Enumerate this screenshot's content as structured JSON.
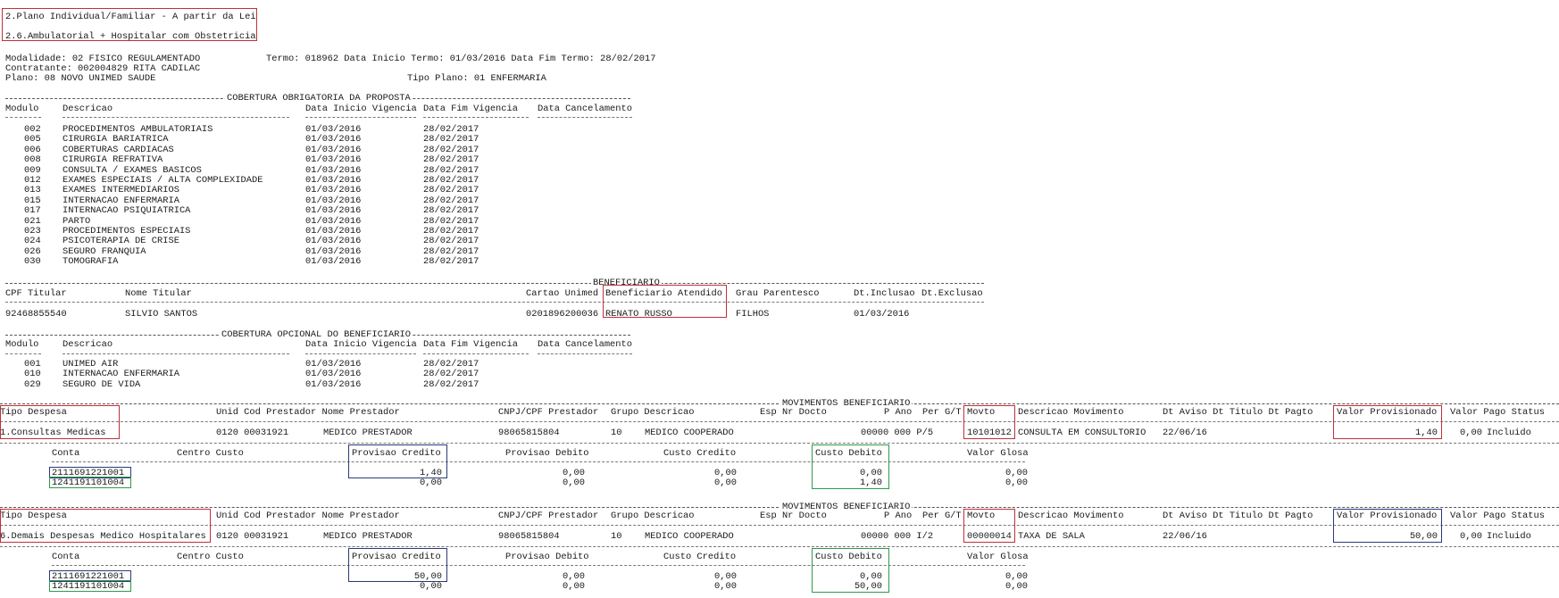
{
  "plan_box": {
    "line1": "2.Plano Individual/Familiar - A partir da Lei",
    "line2": "2.6.Ambulatorial + Hospitalar com Obstetricia"
  },
  "header": {
    "modalidade": "Modalidade: 02 FISICO REGULAMENTADO",
    "termo": "Termo: 018962 Data Inicio Termo: 01/03/2016 Data Fim Termo: 28/02/2017",
    "contratante": "Contratante: 002004829 RITA CADILAC",
    "plano": "Plano: 08 NOVO UNIMED SAUDE",
    "tipo_plano": "Tipo Plano: 01 ENFERMARIA"
  },
  "cobertura_obrigatoria": {
    "title": "COBERTURA OBRIGATORIA DA PROPOSTA",
    "headers": [
      "Modulo",
      "Descricao",
      "Data Inicio Vigencia",
      "Data Fim Vigencia",
      "Data Cancelamento"
    ],
    "rows": [
      [
        "002",
        "PROCEDIMENTOS AMBULATORIAIS",
        "01/03/2016",
        "28/02/2017"
      ],
      [
        "005",
        "CIRURGIA BARIATRICA",
        "01/03/2016",
        "28/02/2017"
      ],
      [
        "006",
        "COBERTURAS CARDIACAS",
        "01/03/2016",
        "28/02/2017"
      ],
      [
        "008",
        "CIRURGIA REFRATIVA",
        "01/03/2016",
        "28/02/2017"
      ],
      [
        "009",
        "CONSULTA / EXAMES BASICOS",
        "01/03/2016",
        "28/02/2017"
      ],
      [
        "012",
        "EXAMES ESPECIAIS / ALTA COMPLEXIDADE",
        "01/03/2016",
        "28/02/2017"
      ],
      [
        "013",
        "EXAMES INTERMEDIARIOS",
        "01/03/2016",
        "28/02/2017"
      ],
      [
        "015",
        "INTERNACAO ENFERMARIA",
        "01/03/2016",
        "28/02/2017"
      ],
      [
        "017",
        "INTERNACAO PSIQUIATRICA",
        "01/03/2016",
        "28/02/2017"
      ],
      [
        "021",
        "PARTO",
        "01/03/2016",
        "28/02/2017"
      ],
      [
        "023",
        "PROCEDIMENTOS ESPECIAIS",
        "01/03/2016",
        "28/02/2017"
      ],
      [
        "024",
        "PSICOTERAPIA DE CRISE",
        "01/03/2016",
        "28/02/2017"
      ],
      [
        "026",
        "SEGURO FRANQUIA",
        "01/03/2016",
        "28/02/2017"
      ],
      [
        "030",
        "TOMOGRAFIA",
        "01/03/2016",
        "28/02/2017"
      ]
    ]
  },
  "beneficiario": {
    "title": "BENEFICIARIO",
    "headers": [
      "CPF Titular",
      "Nome Titular",
      "Cartao Unimed",
      "Beneficiario Atendido",
      "Grau Parentesco",
      "Dt.Inclusao",
      "Dt.Exclusao"
    ],
    "row": [
      "92468855540",
      "SILVIO SANTOS",
      "0201896200036",
      "RENATO RUSSO",
      "FILHOS",
      "01/03/2016",
      ""
    ]
  },
  "cobertura_opcional": {
    "title": "COBERTURA OPCIONAL DO BENEFICIARIO",
    "headers": [
      "Modulo",
      "Descricao",
      "Data Inicio Vigencia",
      "Data Fim Vigencia",
      "Data Cancelamento"
    ],
    "rows": [
      [
        "001",
        "UNIMED AIR",
        "01/03/2016",
        "28/02/2017"
      ],
      [
        "010",
        "INTERNACAO ENFERMARIA",
        "01/03/2016",
        "28/02/2017"
      ],
      [
        "029",
        "SEGURO DE VIDA",
        "01/03/2016",
        "28/02/2017"
      ]
    ]
  },
  "movimentos_title": "MOVIMENTOS BENEFICIARIO",
  "mov_headers": {
    "tipo_despesa": "Tipo Despesa",
    "unid": "Unid Cod Prestador Nome Prestador",
    "cnpj": "CNPJ/CPF Prestador",
    "grupo": "Grupo Descricao",
    "esp": "Esp Nr Docto",
    "pano": "P Ano",
    "per": "Per G/T",
    "movto": "Movto",
    "desc_mov": "Descricao Movimento",
    "dt_aviso": "Dt Aviso Dt Titulo Dt Pagto",
    "valor_prov": "Valor Provisionado",
    "valor_pago": "Valor Pago Status"
  },
  "conta_headers": {
    "conta": "Conta",
    "centro": "Centro Custo",
    "prov_credito": "Provisao Credito",
    "prov_debito": "Provisao Debito",
    "custo_credito": "Custo Credito",
    "custo_debito": "Custo Debito",
    "valor_glosa": "Valor Glosa"
  },
  "movimentos": [
    {
      "tipo_despesa": "1.Consultas Medicas",
      "unid": "0120 00031921",
      "nome_prestador": "MEDICO PRESTADOR",
      "cnpj": "98065815804",
      "grupo": "10",
      "grupo_desc": "MEDICO COOPERADO",
      "ano_per": "00000 000 P/5",
      "movto": "10101012",
      "desc_mov": "CONSULTA EM CONSULTORIO",
      "dt_aviso": "22/06/16",
      "valor_prov": "1,40",
      "valor_pago": "0,00",
      "status": "Incluido",
      "contas": [
        {
          "conta": "2111691221001",
          "prov_credito": "1,40",
          "prov_debito": "0,00",
          "custo_credito": "0,00",
          "custo_debito": "0,00",
          "valor_glosa": "0,00"
        },
        {
          "conta": "1241191101004",
          "prov_credito": "0,00",
          "prov_debito": "0,00",
          "custo_credito": "0,00",
          "custo_debito": "1,40",
          "valor_glosa": "0,00"
        }
      ]
    },
    {
      "tipo_despesa": "6.Demais Despesas Medico Hospitalares",
      "unid": "0120 00031921",
      "nome_prestador": "MEDICO PRESTADOR",
      "cnpj": "98065815804",
      "grupo": "10",
      "grupo_desc": "MEDICO COOPERADO",
      "ano_per": "00000 000 I/2",
      "movto": "00000014",
      "desc_mov": "TAXA DE SALA",
      "dt_aviso": "22/06/16",
      "valor_prov": "50,00",
      "valor_pago": "0,00",
      "status": "Incluido",
      "contas": [
        {
          "conta": "2111691221001",
          "prov_credito": "50,00",
          "prov_debito": "0,00",
          "custo_credito": "0,00",
          "custo_debito": "0,00",
          "valor_glosa": "0,00"
        },
        {
          "conta": "1241191101004",
          "prov_credito": "0,00",
          "prov_debito": "0,00",
          "custo_credito": "0,00",
          "custo_debito": "50,00",
          "valor_glosa": "0,00"
        }
      ]
    }
  ]
}
